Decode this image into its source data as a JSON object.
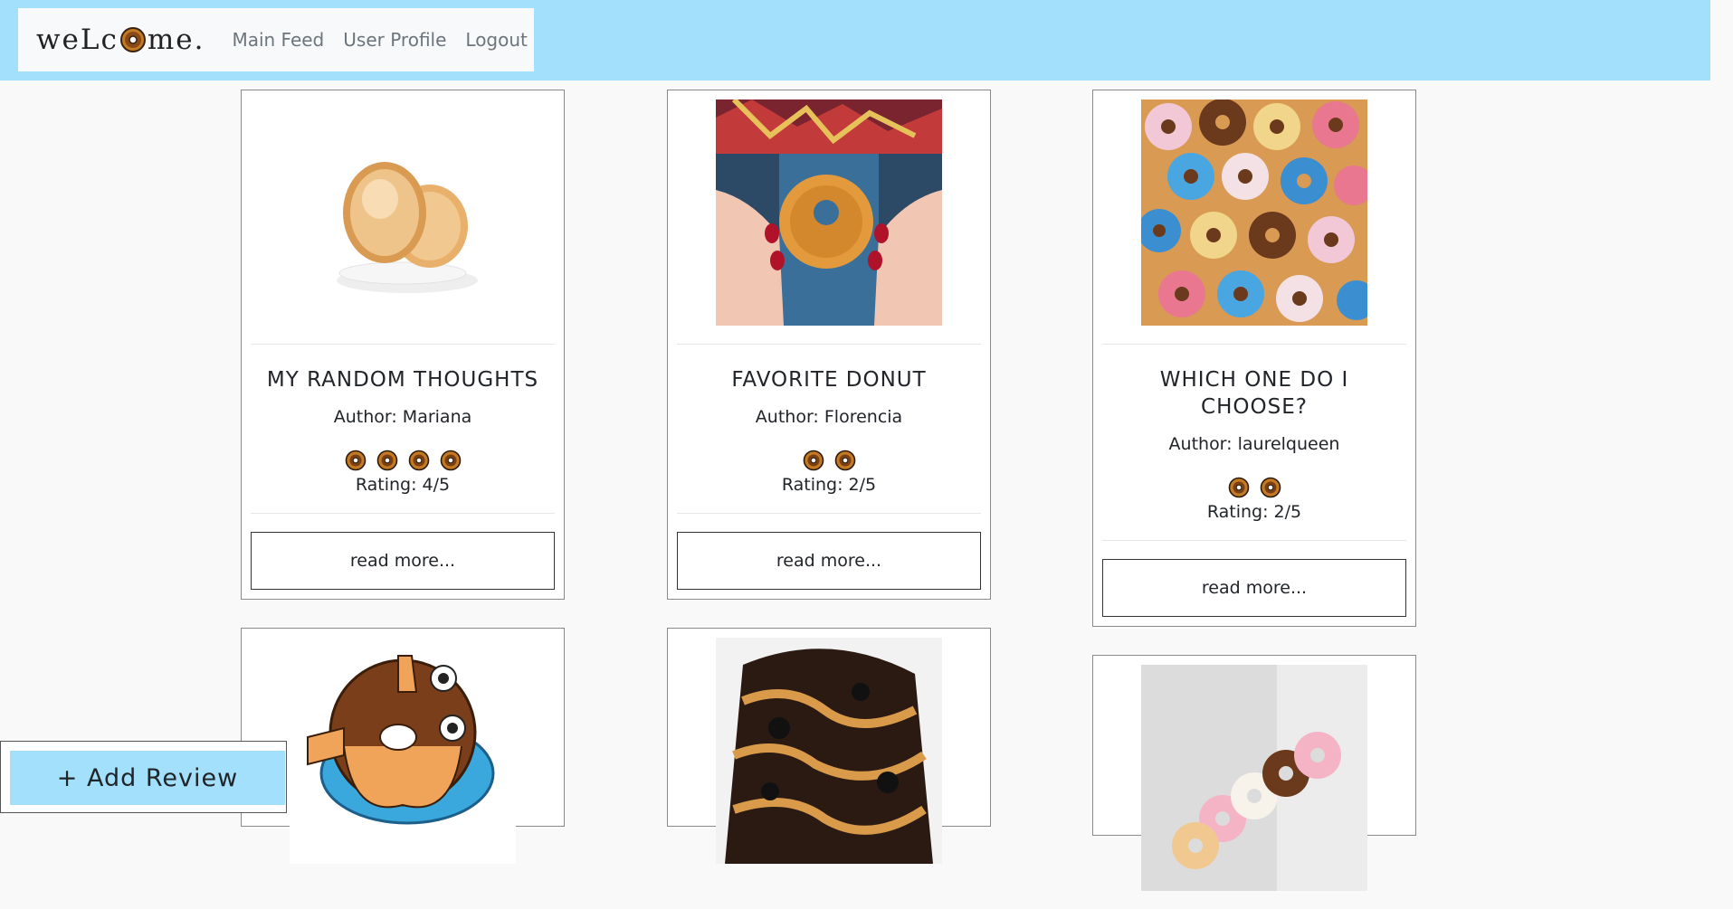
{
  "nav": {
    "brand_before": "weLc",
    "brand_after": "me.",
    "links": [
      "Main Feed",
      "User Profile",
      "Logout"
    ]
  },
  "cards": [
    {
      "title": "MY RANDOM THOUGHTS",
      "author": "Author: Mariana",
      "rating_value": 4,
      "rating_text": "Rating: 4/5",
      "button": "read more...",
      "image": "sugar-donuts-on-plate"
    },
    {
      "title": "FAVORITE DONUT",
      "author": "Author: Florencia",
      "rating_value": 2,
      "rating_text": "Rating: 2/5",
      "button": "read more...",
      "image": "hands-holding-donut"
    },
    {
      "title": "WHICH ONE DO I CHOOSE?",
      "author": "Author: laurelqueen",
      "rating_value": 2,
      "rating_text": "Rating: 2/5",
      "button": "read more...",
      "image": "colorful-donuts"
    },
    {
      "image": "cartoon-donut"
    },
    {
      "image": "chocolate-peanut-donut"
    },
    {
      "image": "donut-box"
    }
  ],
  "add_review": {
    "label": "+ Add Review"
  },
  "colors": {
    "topbar": "#a2e0fb",
    "background": "#f9f9f9",
    "donut": "#c47a22"
  }
}
